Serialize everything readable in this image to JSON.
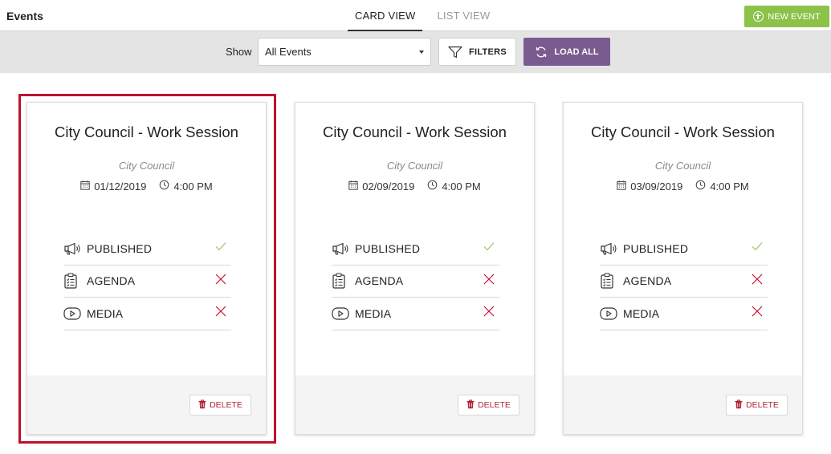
{
  "header": {
    "title": "Events",
    "tabs": [
      {
        "label": "CARD VIEW",
        "active": true
      },
      {
        "label": "LIST VIEW",
        "active": false
      }
    ],
    "new_event_label": "NEW EVENT"
  },
  "toolbar": {
    "show_label": "Show",
    "show_value": "All Events",
    "filters_label": "FILTERS",
    "load_all_label": "LOAD ALL"
  },
  "colors": {
    "new_event": "#8cc24a",
    "load_all": "#7a5b8f",
    "highlight": "#c0102e",
    "check": "#8cc24a",
    "cross": "#c0102e",
    "delete": "#b22234"
  },
  "cards": [
    {
      "title": "City Council - Work Session",
      "subtitle": "City Council",
      "date": "01/12/2019",
      "time": "4:00 PM",
      "statuses": [
        {
          "label": "PUBLISHED",
          "icon": "megaphone-icon",
          "state": "check-icon"
        },
        {
          "label": "AGENDA",
          "icon": "clipboard-icon",
          "state": "cross-icon"
        },
        {
          "label": "MEDIA",
          "icon": "play-icon",
          "state": "cross-icon"
        }
      ],
      "delete_label": "DELETE"
    },
    {
      "title": "City Council - Work Session",
      "subtitle": "City Council",
      "date": "02/09/2019",
      "time": "4:00 PM",
      "statuses": [
        {
          "label": "PUBLISHED",
          "icon": "megaphone-icon",
          "state": "check-icon"
        },
        {
          "label": "AGENDA",
          "icon": "clipboard-icon",
          "state": "cross-icon"
        },
        {
          "label": "MEDIA",
          "icon": "play-icon",
          "state": "cross-icon"
        }
      ],
      "delete_label": "DELETE"
    },
    {
      "title": "City Council - Work Session",
      "subtitle": "City Council",
      "date": "03/09/2019",
      "time": "4:00 PM",
      "statuses": [
        {
          "label": "PUBLISHED",
          "icon": "megaphone-icon",
          "state": "check-icon"
        },
        {
          "label": "AGENDA",
          "icon": "clipboard-icon",
          "state": "cross-icon"
        },
        {
          "label": "MEDIA",
          "icon": "play-icon",
          "state": "cross-icon"
        }
      ],
      "delete_label": "DELETE"
    }
  ]
}
